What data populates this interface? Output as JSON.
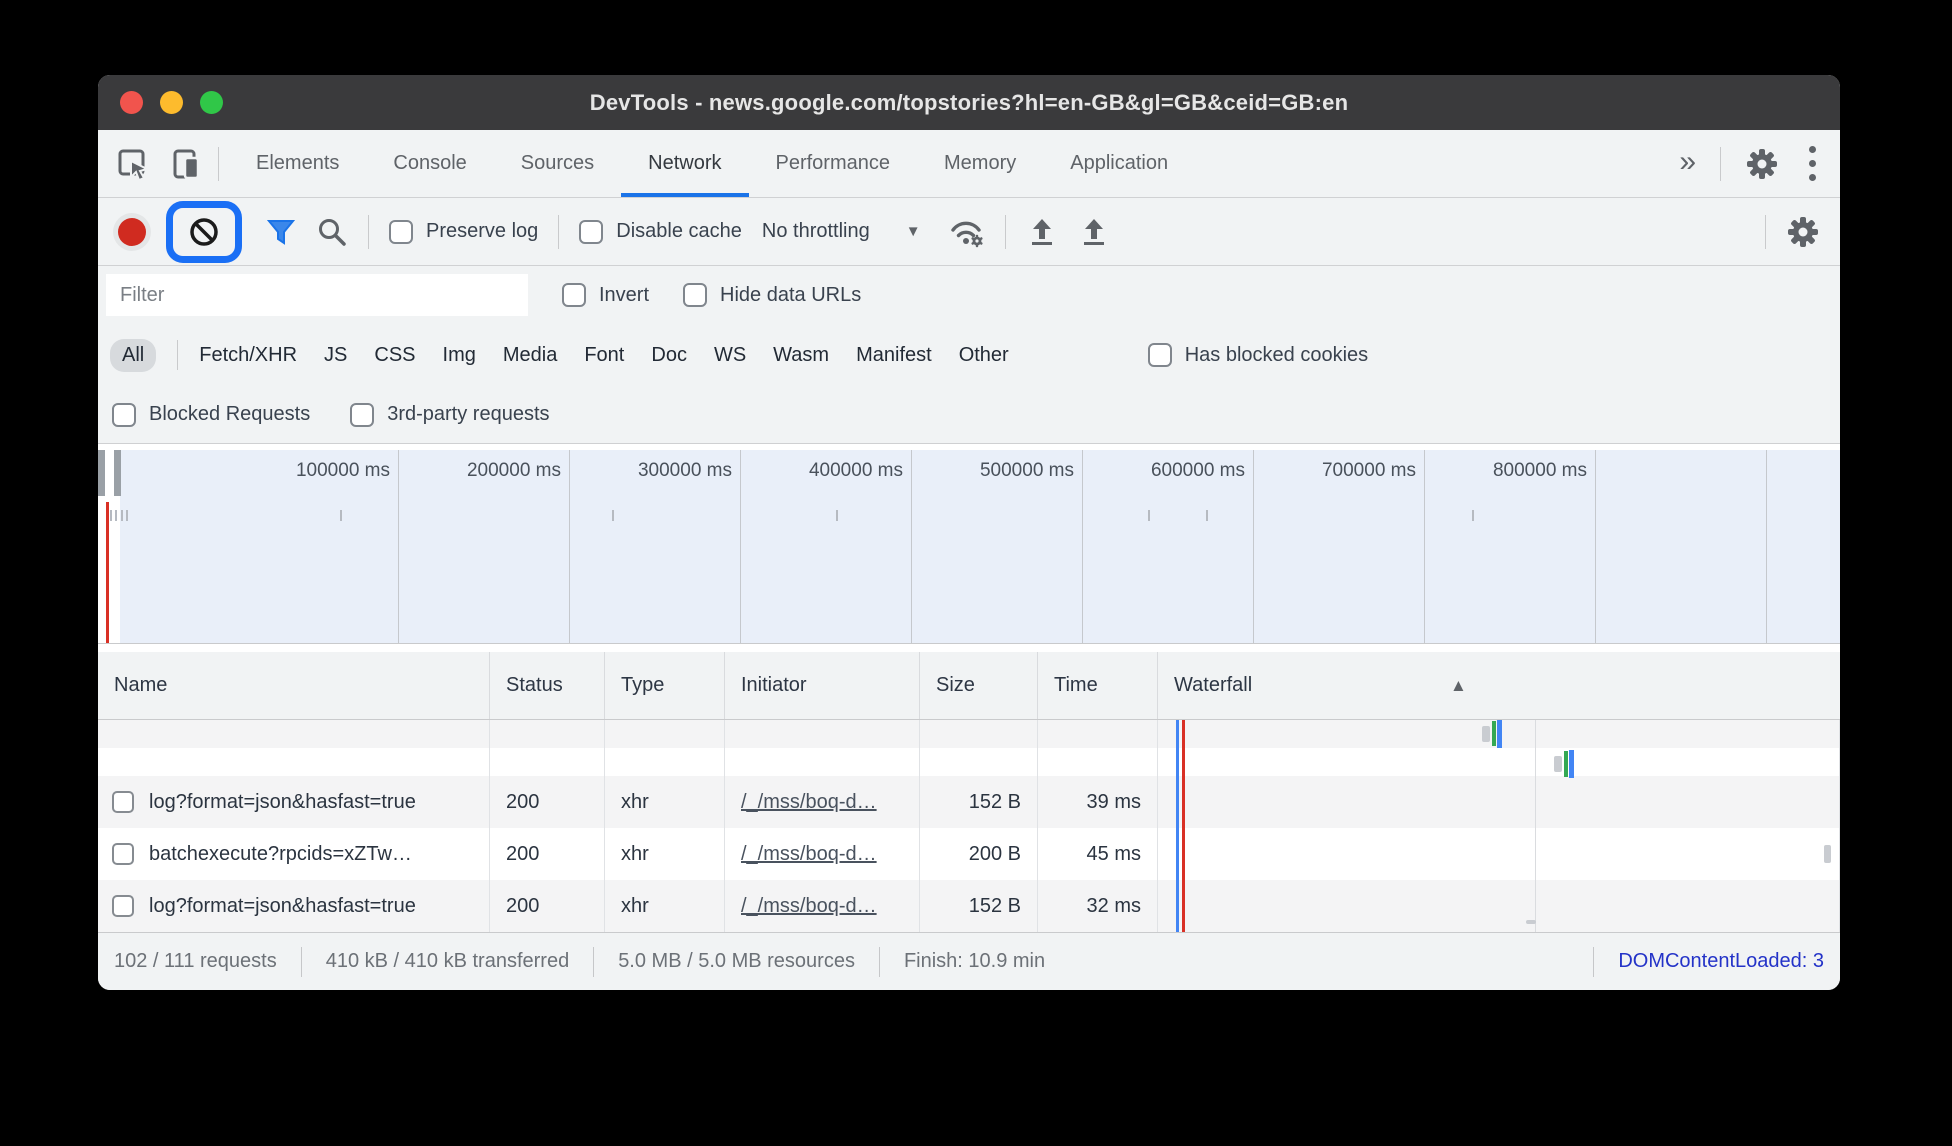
{
  "window": {
    "title": "DevTools - news.google.com/topstories?hl=en-GB&gl=GB&ceid=GB:en"
  },
  "tabs": {
    "items": [
      "Elements",
      "Console",
      "Sources",
      "Network",
      "Performance",
      "Memory",
      "Application"
    ],
    "active": "Network"
  },
  "icons": {
    "more_tabs": "»",
    "dropdown_caret": "▼",
    "sort_asc": "▲"
  },
  "toolbar": {
    "preserve_log": "Preserve log",
    "disable_cache": "Disable cache",
    "throttling_value": "No throttling"
  },
  "filter": {
    "placeholder": "Filter",
    "invert": "Invert",
    "hide_data_urls": "Hide data URLs"
  },
  "chips": [
    "All",
    "Fetch/XHR",
    "JS",
    "CSS",
    "Img",
    "Media",
    "Font",
    "Doc",
    "WS",
    "Wasm",
    "Manifest",
    "Other"
  ],
  "request_filters": {
    "has_blocked_cookies": "Has blocked cookies",
    "blocked": "Blocked Requests",
    "third_party": "3rd-party requests"
  },
  "timeline": {
    "labels": [
      "100000 ms",
      "200000 ms",
      "300000 ms",
      "400000 ms",
      "500000 ms",
      "600000 ms",
      "700000 ms",
      "800000 ms"
    ]
  },
  "table": {
    "columns": [
      "Name",
      "Status",
      "Type",
      "Initiator",
      "Size",
      "Time",
      "Waterfall"
    ],
    "rows": [
      {
        "name": "log?format=json&hasfast=true",
        "status": "200",
        "type": "xhr",
        "initiator": "/_/mss/boq-d…",
        "size": "152 B",
        "time": "39 ms"
      },
      {
        "name": "batchexecute?rpcids=xZTw…",
        "status": "200",
        "type": "xhr",
        "initiator": "/_/mss/boq-d…",
        "size": "200 B",
        "time": "45 ms"
      },
      {
        "name": "log?format=json&hasfast=true",
        "status": "200",
        "type": "xhr",
        "initiator": "/_/mss/boq-d…",
        "size": "152 B",
        "time": "32 ms"
      }
    ]
  },
  "status_bar": {
    "items": [
      "102 / 111 requests",
      "410 kB / 410 kB transferred",
      "5.0 MB / 5.0 MB resources",
      "Finish: 10.9 min"
    ],
    "dom_content_loaded": "DOMContentLoaded: 3"
  },
  "colors": {
    "accent_blue": "#1a73e8",
    "annotation_highlight": "#1a6ff5",
    "record_red": "#d02b20",
    "waterfall_red_line": "#d93025",
    "waterfall_blue_line": "#4285f4",
    "waterfall_green_bar": "#34a853",
    "dcl_blue": "#2433c8",
    "toolbar_bg": "#f1f3f4",
    "titlebar_bg": "#3a3a3c",
    "timeline_bg": "#e9eff9"
  }
}
